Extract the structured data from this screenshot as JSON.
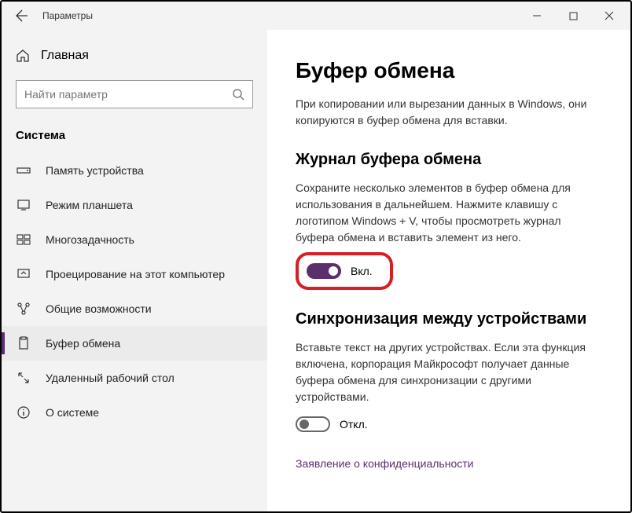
{
  "titlebar": {
    "title": "Параметры"
  },
  "sidebar": {
    "home": "Главная",
    "search_placeholder": "Найти параметр",
    "section": "Система",
    "items": [
      {
        "label": "Память устройства"
      },
      {
        "label": "Режим планшета"
      },
      {
        "label": "Многозадачность"
      },
      {
        "label": "Проецирование на этот компьютер"
      },
      {
        "label": "Общие возможности"
      },
      {
        "label": "Буфер обмена"
      },
      {
        "label": "Удаленный рабочий стол"
      },
      {
        "label": "О системе"
      }
    ]
  },
  "main": {
    "title": "Буфер обмена",
    "intro": "При копировании или вырезании данных в Windows, они копируются в буфер обмена для вставки.",
    "history_title": "Журнал буфера обмена",
    "history_desc": "Сохраните несколько элементов в буфер обмена для использования в дальнейшем. Нажмите клавишу с логотипом Windows + V, чтобы просмотреть журнал буфера обмена и вставить элемент из него.",
    "history_toggle_label": "Вкл.",
    "sync_title": "Синхронизация между устройствами",
    "sync_desc": "Вставьте текст на других устройствах. Если эта функция включена, корпорация Майкрософт получает данные буфера обмена для синхронизации с другими устройствами.",
    "sync_toggle_label": "Откл.",
    "privacy_link": "Заявление о конфиденциальности"
  }
}
